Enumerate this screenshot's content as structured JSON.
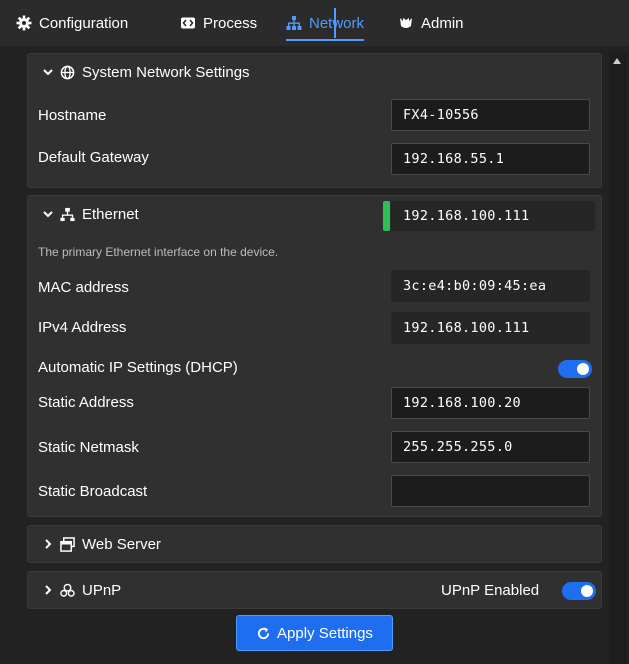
{
  "nav": {
    "tabs": [
      {
        "label": "Configuration",
        "icon": "gear-icon"
      },
      {
        "label": "Process",
        "icon": "process-icon"
      },
      {
        "label": "Network",
        "icon": "network-icon",
        "active": true
      },
      {
        "label": "Admin",
        "icon": "admin-icon"
      }
    ]
  },
  "system": {
    "header": "System Network Settings",
    "hostname_label": "Hostname",
    "hostname_value": "FX4-10556",
    "gateway_label": "Default Gateway",
    "gateway_value": "192.168.55.1"
  },
  "ethernet": {
    "header": "Ethernet",
    "header_ip": "192.168.100.111",
    "link_status_color": "#2fbf55",
    "description": "The primary Ethernet interface on the device.",
    "mac_label": "MAC address",
    "mac_value": "3c:e4:b0:09:45:ea",
    "ipv4_label": "IPv4 Address",
    "ipv4_value": "192.168.100.111",
    "dhcp_label": "Automatic IP Settings (DHCP)",
    "dhcp_enabled": true,
    "static_address_label": "Static Address",
    "static_address_value": "192.168.100.20",
    "static_netmask_label": "Static Netmask",
    "static_netmask_value": "255.255.255.0",
    "static_broadcast_label": "Static Broadcast",
    "static_broadcast_value": ""
  },
  "webserver": {
    "header": "Web Server"
  },
  "upnp": {
    "header": "UPnP",
    "enabled_label": "UPnP Enabled",
    "enabled": true
  },
  "apply_label": "Apply Settings",
  "colors": {
    "accent": "#1f6ef0",
    "active_tab": "#4d9cff",
    "background": "#222222",
    "panel": "#303030"
  }
}
